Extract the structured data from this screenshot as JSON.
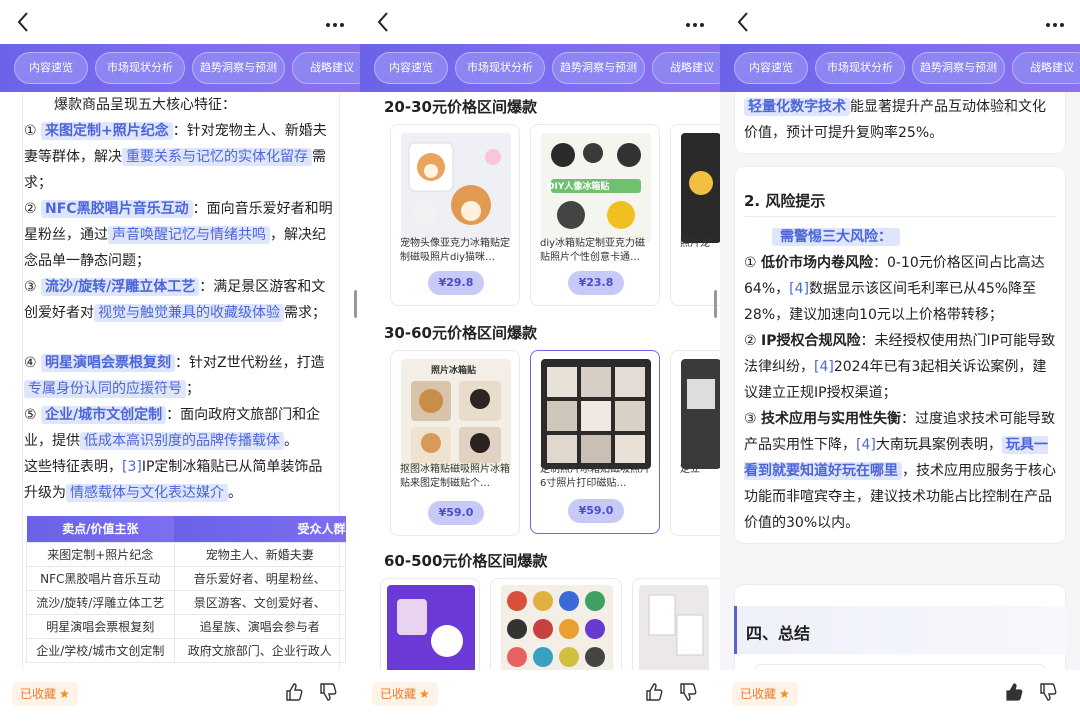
{
  "tabs": [
    "内容速览",
    "市场现状分析",
    "趋势洞察与预测",
    "战略建议"
  ],
  "bottom": {
    "fav_label": "已收藏",
    "star": "★"
  },
  "panel1": {
    "intro": "爆款商品呈现五大核心特征：",
    "items": [
      {
        "num": "①",
        "key": "来图定制+照片纪念",
        "a": "：针对宠物主人、新婚夫妻等群体，解决",
        "hl": "重要关系与记忆的实体化留存",
        "b": "需求；"
      },
      {
        "num": "②",
        "key": "NFC黑胶唱片音乐互动",
        "a": "：面向音乐爱好者和明星粉丝，通过",
        "hl": "声音唤醒记忆与情绪共鸣",
        "b": "，解决纪念品单一静态问题；"
      },
      {
        "num": "③",
        "key": "流沙/旋转/浮雕立体工艺",
        "a": "：满足景区游客和文创爱好者对",
        "hl": "视觉与触觉兼具的收藏级体验",
        "b": "需求；"
      },
      {
        "num": "④",
        "key": "明星演唱会票根复刻",
        "a": "：针对Z世代粉丝，打造",
        "hl": "专属身份认同的应援符号",
        "b": "；"
      },
      {
        "num": "⑤",
        "key": "企业/城市文创定制",
        "a": "：面向政府文旅部门和企业，提供",
        "hl": "低成本高识别度的品牌传播载体",
        "b": "。"
      }
    ],
    "summary_a": "这些特征表明，",
    "summary_ref": "[3]",
    "summary_b": "IP定制冰箱贴已从简单装饰品升级为",
    "summary_hl": "情感载体与文化表达媒介",
    "summary_c": "。",
    "table": {
      "headers": [
        "卖点/价值主张",
        "受众人群"
      ],
      "rows": [
        [
          "来图定制+照片纪念",
          "宠物主人、新婚夫妻"
        ],
        [
          "NFC黑胶唱片音乐互动",
          "音乐爱好者、明星粉丝、"
        ],
        [
          "流沙/旋转/浮雕立体工艺",
          "景区游客、文创爱好者、"
        ],
        [
          "明星演唱会票根复刻",
          "追星族、演唱会参与者"
        ],
        [
          "企业/学校/城市文创定制",
          "政府文旅部门、企业行政人"
        ]
      ]
    }
  },
  "panel2": {
    "sections": [
      "20-30元价格区间爆款",
      "30-60元价格区间爆款",
      "60-500元价格区间爆款"
    ],
    "row1": [
      {
        "title": "宠物头像亚克力冰箱贴定制磁吸照片diy猫咪…",
        "price": "¥29.8"
      },
      {
        "title": "diy冰箱贴定制亚克力磁贴照片个性创意卡通…",
        "price": "¥23.8"
      },
      {
        "title": "照片宠",
        "price": ""
      }
    ],
    "row2": [
      {
        "title": "抠图冰箱贴磁吸照片冰箱贴来图定制磁贴个…",
        "price": "¥59.0"
      },
      {
        "title": "定制照片冰箱贴磁吸照片6寸照片打印磁贴…",
        "price": "¥59.0"
      },
      {
        "title": "定立",
        "price": ""
      }
    ],
    "img_text": {
      "r1c2": "DIY人像冰箱贴",
      "r2c1": "照片冰箱贴"
    }
  },
  "panel3": {
    "top_hl": "轻量化数字技术",
    "top_text": "能显著提升产品互动体验和文化价值，预计可提升复购率25%。",
    "risk_title": "2. 风险提示",
    "risk_hl": "需警惕三大风险：",
    "risks": [
      {
        "num": "①",
        "key": "低价市场内卷风险",
        "a": "：0-10元价格区间占比高达64%，",
        "ref": "[4]",
        "b": "数据显示该区间毛利率已从45%降至28%，建议加速向10元以上价格带转移；"
      },
      {
        "num": "②",
        "key": "IP授权合规风险",
        "a": "：未经授权使用热门IP可能导致法律纠纷，",
        "ref": "[4]",
        "b": "2024年已有3起相关诉讼案例，建议建立正规IP授权渠道；"
      },
      {
        "num": "③",
        "key": "技术应用与实用性失衡",
        "a": "：过度追求技术可能导致产品实用性下降，",
        "ref": "[4]",
        "b": "大南玩具案例表明，",
        "hl": "玩具一看到就要知道好玩在哪里",
        "c": "，技术应用应服务于核心功能而非喧宾夺主，建议技术功能占比控制在产品价值的30%以内。"
      }
    ],
    "summary_title": "四、总结"
  }
}
